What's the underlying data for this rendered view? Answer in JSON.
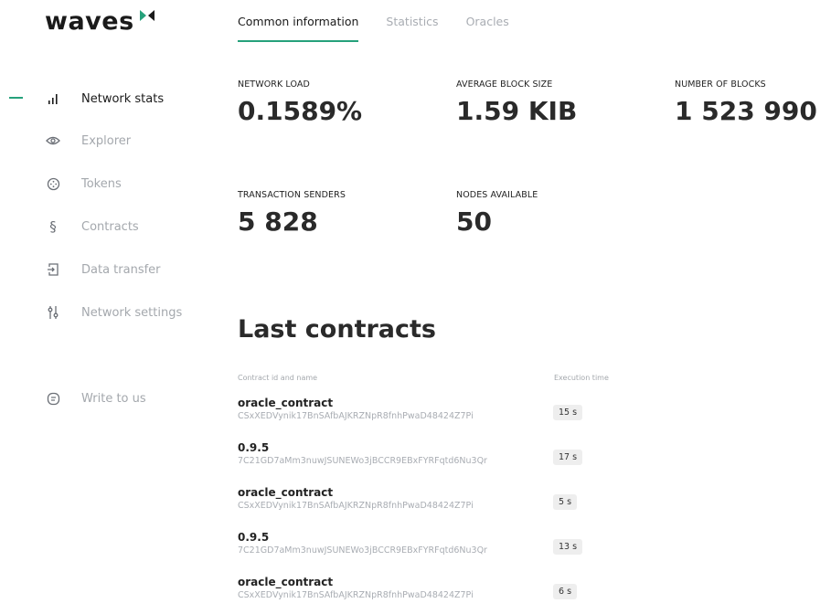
{
  "brand": {
    "name": "waves"
  },
  "tabs": [
    {
      "label": "Common information",
      "active": true
    },
    {
      "label": "Statistics",
      "active": false
    },
    {
      "label": "Oracles",
      "active": false
    }
  ],
  "sidebar": {
    "items": [
      {
        "label": "Network stats",
        "icon": "bar-chart-icon",
        "active": true
      },
      {
        "label": "Explorer",
        "icon": "eye-icon",
        "active": false
      },
      {
        "label": "Tokens",
        "icon": "token-icon",
        "active": false
      },
      {
        "label": "Contracts",
        "icon": "section-icon",
        "active": false
      },
      {
        "label": "Data transfer",
        "icon": "data-transfer-icon",
        "active": false
      },
      {
        "label": "Network settings",
        "icon": "sliders-icon",
        "active": false
      }
    ],
    "footer_item": {
      "label": "Write to us",
      "icon": "chat-icon"
    }
  },
  "stats": [
    {
      "label": "NETWORK LOAD",
      "value": "0.1589%"
    },
    {
      "label": "AVERAGE BLOCK SIZE",
      "value": "1.59 KIB"
    },
    {
      "label": "NUMBER OF BLOCKS",
      "value": "1 523 990"
    },
    {
      "label": "TRANSACTION SENDERS",
      "value": "5 828"
    },
    {
      "label": "NODES AVAILABLE",
      "value": "50"
    }
  ],
  "contracts": {
    "title": "Last contracts",
    "columns": [
      "Contract id and name",
      "Execution time"
    ],
    "rows": [
      {
        "name": "oracle_contract",
        "id": "CSxXEDVynik17BnSAfbAJKRZNpR8fnhPwaD48424Z7Pi",
        "time": "15 s"
      },
      {
        "name": "0.9.5",
        "id": "7C21GD7aMm3nuwJSUNEWo3jBCCR9EBxFYRFqtd6Nu3Qr",
        "time": "17 s"
      },
      {
        "name": "oracle_contract",
        "id": "CSxXEDVynik17BnSAfbAJKRZNpR8fnhPwaD48424Z7Pi",
        "time": "5 s"
      },
      {
        "name": "0.9.5",
        "id": "7C21GD7aMm3nuwJSUNEWo3jBCCR9EBxFYRFqtd6Nu3Qr",
        "time": "13 s"
      },
      {
        "name": "oracle_contract",
        "id": "CSxXEDVynik17BnSAfbAJKRZNpR8fnhPwaD48424Z7Pi",
        "time": "6 s"
      }
    ]
  },
  "colors": {
    "accent": "#26a17b"
  }
}
